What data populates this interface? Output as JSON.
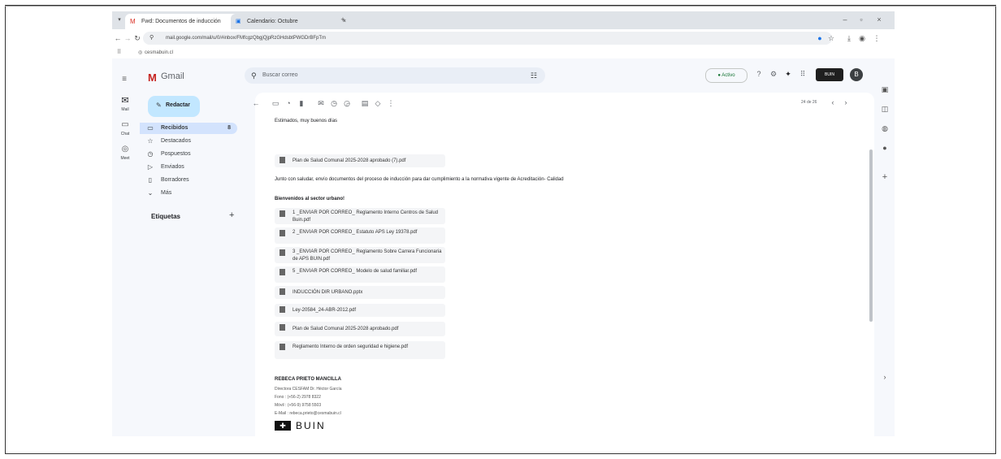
{
  "browser": {
    "tabs": [
      {
        "label": "Fwd: Documentos de inducción",
        "active": true
      },
      {
        "label": "Calendario: Octubre",
        "active": false
      }
    ],
    "new_tab_symbol": "+",
    "address": "mail.google.com/mail/u/0/#inbox/FMfcgzQbgjQjpRzGHdsbtPWGDrBFpTm",
    "bookmark": "cesmabuin.cl",
    "window_controls": {
      "minimize": "–",
      "maximize": "▫",
      "close": "×"
    }
  },
  "gmail": {
    "logo_text": "Gmail",
    "compose_label": "Redactar",
    "search_placeholder": "Buscar correo",
    "status_label": "● Activo",
    "avatar_letter": "B",
    "brand_badge": "BUIN",
    "pager": "24 de 26",
    "rail": [
      {
        "icon": "mail-icon",
        "label": "Mail"
      },
      {
        "icon": "chat-icon",
        "label": "Chat"
      },
      {
        "icon": "meet-icon",
        "label": "Meet"
      }
    ],
    "nav": [
      {
        "icon": "inbox-icon",
        "label": "Recibidos",
        "count": "8",
        "active": true
      },
      {
        "icon": "star-icon",
        "label": "Destacados",
        "count": ""
      },
      {
        "icon": "clock-icon",
        "label": "Pospuestos",
        "count": ""
      },
      {
        "icon": "send-icon",
        "label": "Enviados",
        "count": ""
      },
      {
        "icon": "draft-icon",
        "label": "Borradores",
        "count": ""
      },
      {
        "icon": "chevron-down-icon",
        "label": "Más",
        "count": ""
      }
    ],
    "labels_title": "Etiquetas",
    "labels_add": "+"
  },
  "email": {
    "greeting": "Estimados, muy buenos días",
    "first_attachment": "Plan de Salud Comunal 2025-2028 aprobado (7).pdf",
    "paragraph": "Junto con saludar, envío documentos del proceso de inducción para dar cumplimiento a la normativa vigente de Acreditación- Calidad",
    "welcome": "Bienvenidos al sector urbano!",
    "attachments": [
      "1 _ENVIAR POR CORREO_ Reglamento Interno Centros de Salud Buin.pdf",
      "2 _ENVIAR POR CORREO_ Estatuto APS Ley 19378.pdf",
      "3 _ENVIAR POR CORREO_ Reglamento Sobre Carrera Funcionaria de APS BUIN.pdf",
      "5 _ENVIAR POR CORREO_ Modelo de salud familiar.pdf",
      "INDUCCIÓN DIR URBANO.pptx",
      "Ley-20584_24-ABR-2012.pdf",
      "Plan de Salud Comunal 2025-2028 aprobado.pdf",
      "Reglamento Interno de orden seguridad e higiene.pdf"
    ],
    "signature": {
      "name": "REBECA PRIETO MANCILLA",
      "role": "Directora CESFAM Dr. Héctor García",
      "phone": "Fono    : (+56-2) 2978 8322",
      "mobile": "Móvil    : (+56-9) 9758 5503",
      "email": "E-Mail  : rebeca.prieto@cesmabuin.cl",
      "logo_text": "BUIN"
    }
  }
}
